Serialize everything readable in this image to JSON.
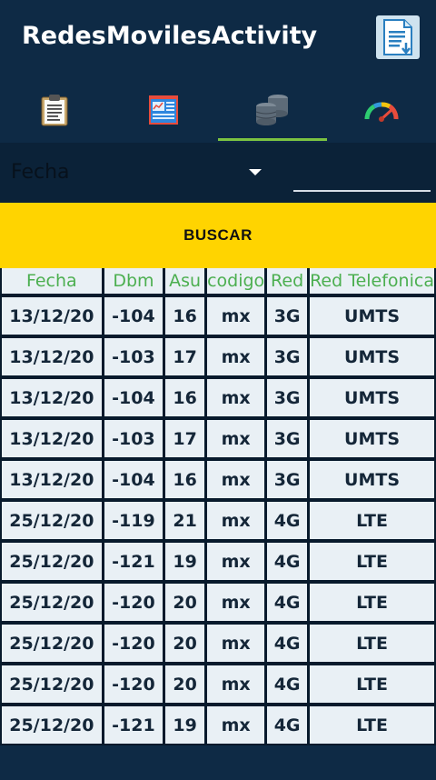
{
  "app": {
    "title": "RedesMovilesActivity",
    "action_icon": "document-download-icon"
  },
  "tabs": [
    {
      "icon": "clipboard-icon",
      "selected": false
    },
    {
      "icon": "chart-report-icon",
      "selected": false
    },
    {
      "icon": "database-icon",
      "selected": true
    },
    {
      "icon": "gauge-icon",
      "selected": false
    }
  ],
  "colors": {
    "primary": "#0e2a45",
    "accent": "#ffd400",
    "tab_indicator": "#7cc341",
    "header_text": "#4caf50"
  },
  "filter": {
    "spinner_value": "Fecha",
    "input_value": ""
  },
  "search_button": {
    "label": "BUSCAR"
  },
  "table": {
    "headers": [
      "Fecha",
      "Dbm",
      "Asu",
      "codigo",
      "Red",
      "Red Telefonica"
    ],
    "rows": [
      [
        "13/12/20",
        "-104",
        "16",
        "mx",
        "3G",
        "UMTS"
      ],
      [
        "13/12/20",
        "-103",
        "17",
        "mx",
        "3G",
        "UMTS"
      ],
      [
        "13/12/20",
        "-104",
        "16",
        "mx",
        "3G",
        "UMTS"
      ],
      [
        "13/12/20",
        "-103",
        "17",
        "mx",
        "3G",
        "UMTS"
      ],
      [
        "13/12/20",
        "-104",
        "16",
        "mx",
        "3G",
        "UMTS"
      ],
      [
        "25/12/20",
        "-119",
        "21",
        "mx",
        "4G",
        "LTE"
      ],
      [
        "25/12/20",
        "-121",
        "19",
        "mx",
        "4G",
        "LTE"
      ],
      [
        "25/12/20",
        "-120",
        "20",
        "mx",
        "4G",
        "LTE"
      ],
      [
        "25/12/20",
        "-120",
        "20",
        "mx",
        "4G",
        "LTE"
      ],
      [
        "25/12/20",
        "-120",
        "20",
        "mx",
        "4G",
        "LTE"
      ],
      [
        "25/12/20",
        "-121",
        "19",
        "mx",
        "4G",
        "LTE"
      ]
    ]
  }
}
